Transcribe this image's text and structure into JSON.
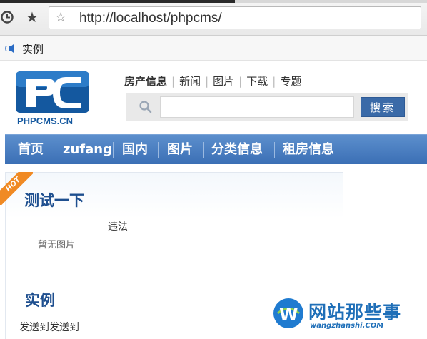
{
  "browser": {
    "url": "http://localhost/phpcms/",
    "history_icon": "history-icon",
    "bookmarks_icon": "star-filled-icon",
    "bookmark_star_icon": "star-outline-icon"
  },
  "bookmarks_bar": {
    "label": "实例",
    "icon": "speaker-icon"
  },
  "header": {
    "logo_text": "PHPCMS.CN",
    "categories": [
      "房产信息",
      "新闻",
      "图片",
      "下载",
      "专题"
    ],
    "search": {
      "placeholder": "",
      "value": "",
      "button_label": "搜索",
      "icon": "search-icon"
    }
  },
  "nav": {
    "items": [
      "首页",
      "zufang",
      "国内",
      "图片",
      "分类信息",
      "租房信息"
    ]
  },
  "content": {
    "badge": "HOT",
    "sections": [
      {
        "title": "测试一下",
        "item_title": "违法",
        "no_image": "暂无图片"
      },
      {
        "title": "实例",
        "item_text": "发送到发送到"
      }
    ]
  },
  "watermark": {
    "title": "网站那些事",
    "subtitle": "wangzhanshi.COM"
  },
  "colors": {
    "nav_blue": "#3b6fb5",
    "title_blue": "#1e4f8f",
    "hot_orange": "#f08a24"
  }
}
